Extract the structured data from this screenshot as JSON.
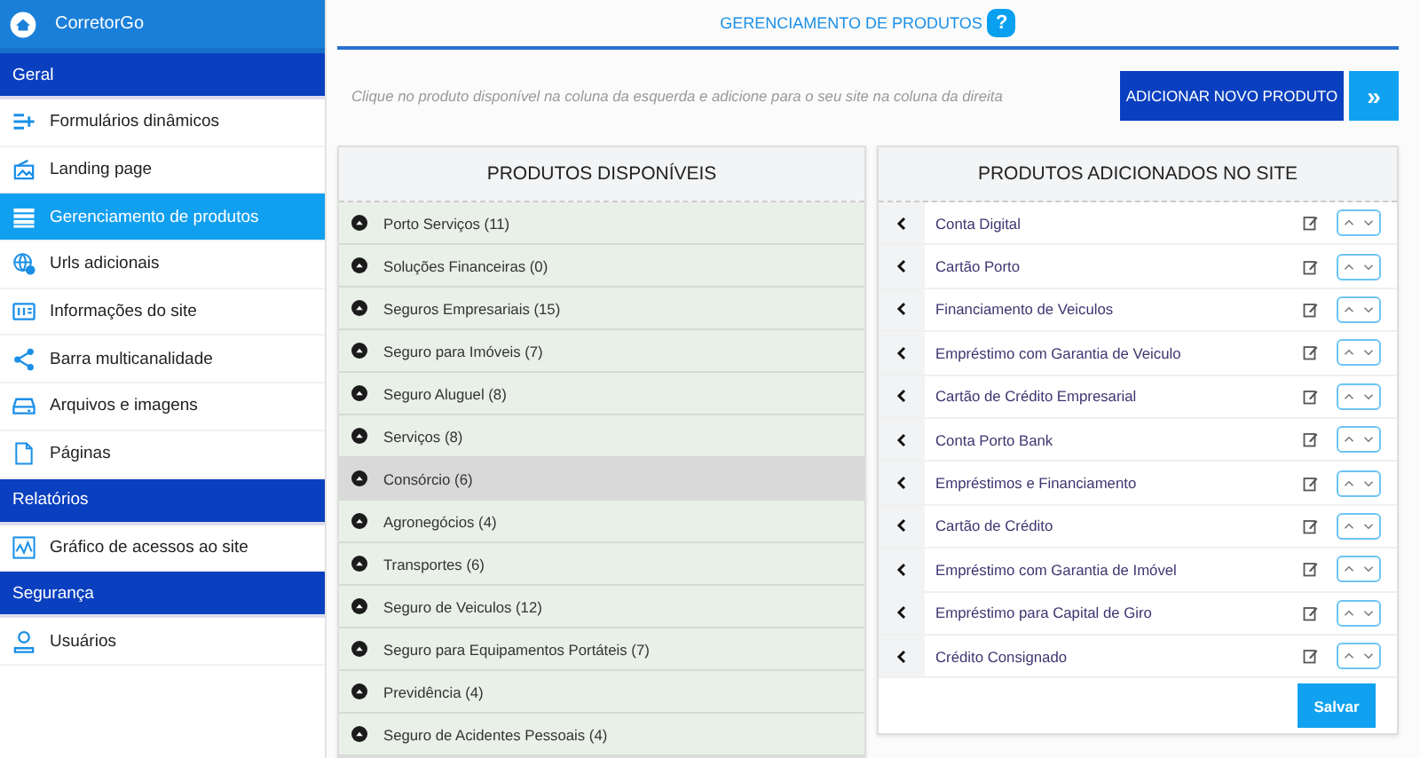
{
  "brand": {
    "name": "CorretorGo"
  },
  "sidebar": {
    "sections": [
      {
        "title": "Geral",
        "items": [
          {
            "label": "Formulários dinâmicos",
            "kind": "form",
            "selected": false
          },
          {
            "label": "Landing page",
            "kind": "landing",
            "selected": false
          },
          {
            "label": "Gerenciamento de produtos",
            "kind": "list",
            "selected": true
          },
          {
            "label": "Urls adicionais",
            "kind": "globe",
            "selected": false
          },
          {
            "label": "Informações do site",
            "kind": "info",
            "selected": false
          },
          {
            "label": "Barra multicanalidade",
            "kind": "share",
            "selected": false
          },
          {
            "label": "Arquivos e imagens",
            "kind": "drive",
            "selected": false
          },
          {
            "label": "Páginas",
            "kind": "page",
            "selected": false
          }
        ]
      },
      {
        "title": "Relatórios",
        "items": [
          {
            "label": "Gráfico de acessos ao site",
            "kind": "chart",
            "selected": false
          }
        ]
      },
      {
        "title": "Segurança",
        "items": [
          {
            "label": "Usuários",
            "kind": "user",
            "selected": false
          }
        ]
      }
    ]
  },
  "page": {
    "title": "GERENCIAMENTO DE PRODUTOS",
    "help": "?",
    "hint": "Clique no produto disponível na coluna da esquerda e adicione para o seu site na coluna da direita",
    "add_button": "ADICIONAR NOVO PRODUTO",
    "expand_button": "»"
  },
  "available": {
    "title": "PRODUTOS DISPONÍVEIS",
    "items": [
      {
        "label": "Porto Serviços (11)",
        "selected": false
      },
      {
        "label": "Soluções Financeiras (0)",
        "selected": false
      },
      {
        "label": "Seguros Empresariais (15)",
        "selected": false
      },
      {
        "label": "Seguro para Imóveis (7)",
        "selected": false
      },
      {
        "label": "Seguro Aluguel (8)",
        "selected": false
      },
      {
        "label": "Serviços (8)",
        "selected": false
      },
      {
        "label": "Consórcio (6)",
        "selected": true
      },
      {
        "label": "Agronegócios (4)",
        "selected": false
      },
      {
        "label": "Transportes (6)",
        "selected": false
      },
      {
        "label": "Seguro de Veiculos (12)",
        "selected": false
      },
      {
        "label": "Seguro para Equipamentos Portáteis (7)",
        "selected": false
      },
      {
        "label": "Previdência (4)",
        "selected": false
      },
      {
        "label": "Seguro de Acidentes Pessoais (4)",
        "selected": false
      }
    ]
  },
  "added": {
    "title": "PRODUTOS ADICIONADOS NO SITE",
    "items": [
      "Conta Digital",
      "Cartão Porto",
      "Financiamento de Veiculos",
      "Empréstimo com Garantia de Veiculo",
      "Cartão de Crédito Empresarial",
      "Conta Porto Bank",
      "Empréstimos e Financiamento",
      "Cartão de Crédito",
      "Empréstimo com Garantia de Imóvel",
      "Empréstimo para Capital de Giro",
      "Crédito Consignado"
    ],
    "save_button": "Salvar"
  }
}
